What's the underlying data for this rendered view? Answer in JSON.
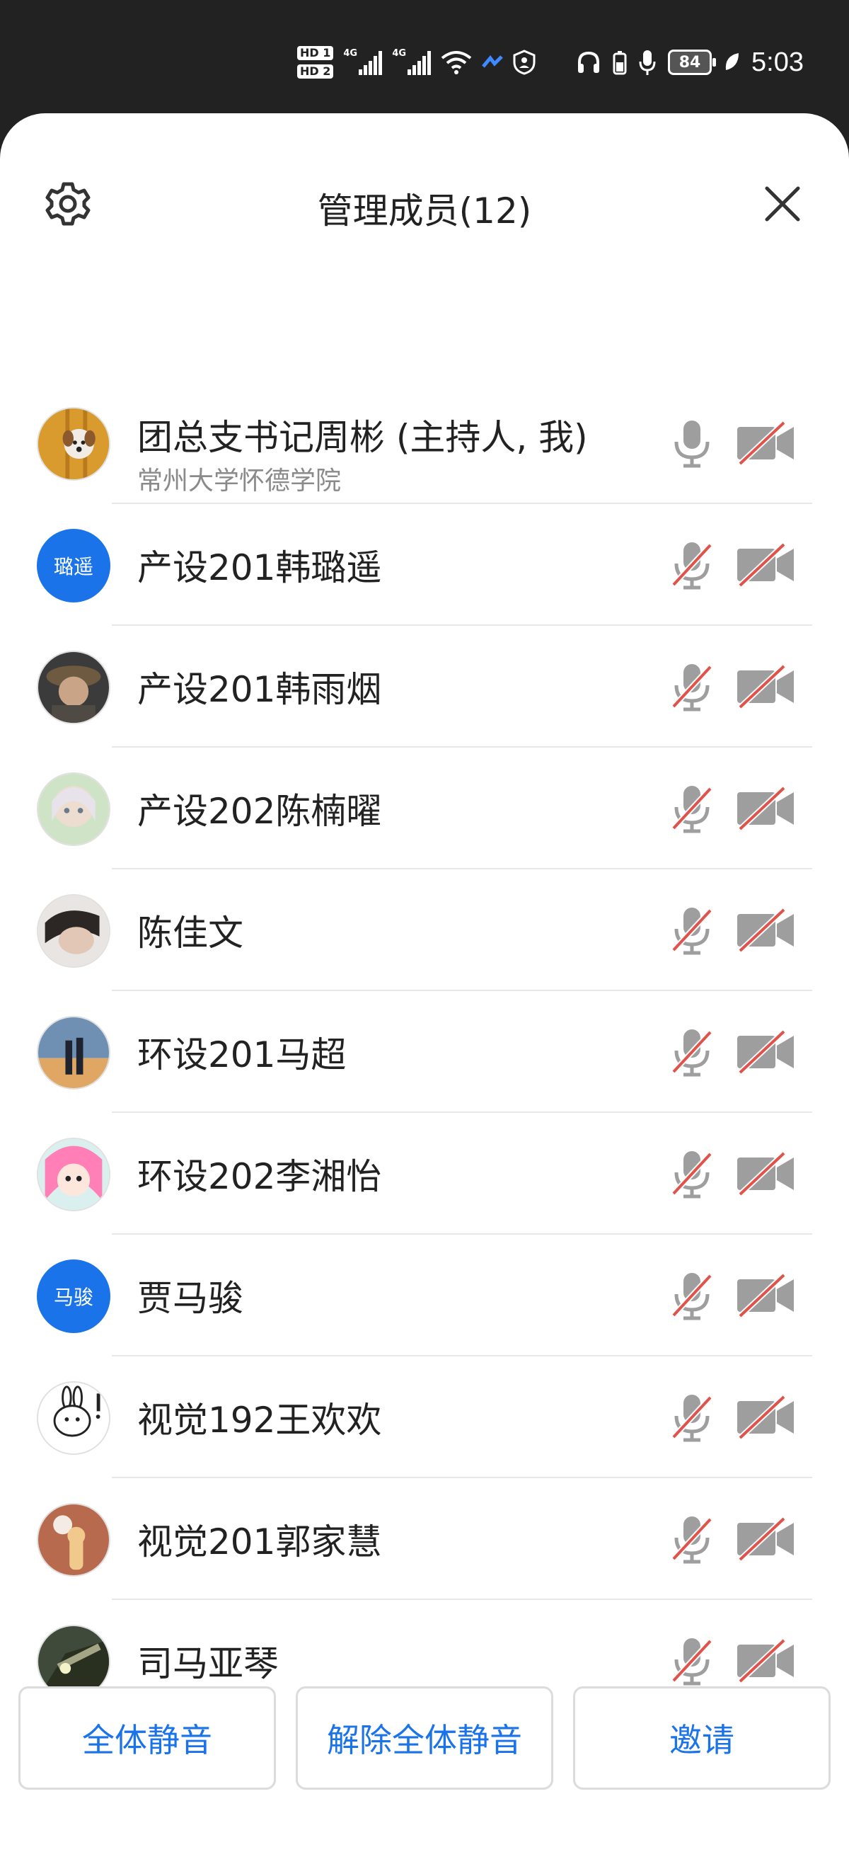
{
  "status_bar": {
    "hd1": "HD 1",
    "hd2": "HD 2",
    "net1": "4G",
    "net2": "4G",
    "battery": "84",
    "time": "5:03"
  },
  "header": {
    "title": "管理成员(12)",
    "settings_icon": "gear-icon",
    "close_icon": "close-icon"
  },
  "members": [
    {
      "name": "团总支书记周彬 (主持人, 我)",
      "subtitle": "常州大学怀德学院",
      "avatar_text": "",
      "mic_muted": false,
      "cam_off": true
    },
    {
      "name": "产设201韩璐遥",
      "avatar_text": "璐遥",
      "mic_muted": true,
      "cam_off": true
    },
    {
      "name": "产设201韩雨烟",
      "avatar_text": "",
      "mic_muted": true,
      "cam_off": true
    },
    {
      "name": "产设202陈楠曜",
      "avatar_text": "",
      "mic_muted": true,
      "cam_off": true
    },
    {
      "name": "陈佳文",
      "avatar_text": "",
      "mic_muted": true,
      "cam_off": true
    },
    {
      "name": "环设201马超",
      "avatar_text": "",
      "mic_muted": true,
      "cam_off": true
    },
    {
      "name": "环设202李湘怡",
      "avatar_text": "",
      "mic_muted": true,
      "cam_off": true
    },
    {
      "name": "贾马骏",
      "avatar_text": "马骏",
      "mic_muted": true,
      "cam_off": true
    },
    {
      "name": "视觉192王欢欢",
      "avatar_text": "",
      "mic_muted": true,
      "cam_off": true
    },
    {
      "name": "视觉201郭家慧",
      "avatar_text": "",
      "mic_muted": true,
      "cam_off": true
    },
    {
      "name": "司马亚琴",
      "avatar_text": "",
      "mic_muted": true,
      "cam_off": true
    }
  ],
  "actions": {
    "mute_all": "全体静音",
    "unmute_all": "解除全体静音",
    "invite": "邀请"
  },
  "colors": {
    "accent": "#1a73e8",
    "muted_slash": "#e0524a",
    "icon_gray": "#9e9e9e"
  }
}
